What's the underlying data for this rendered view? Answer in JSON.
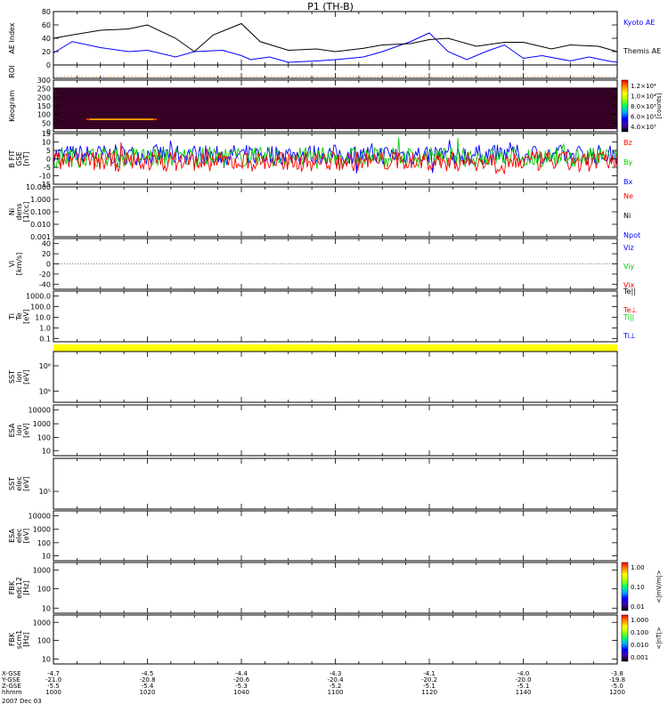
{
  "title": "P1 (TH-B)",
  "colors": {
    "black": "#000000",
    "red": "#ff0000",
    "green": "#00cc00",
    "blue": "#0000ff",
    "yellow": "#ffff00",
    "orange": "#ff9900",
    "kgram_bg": "#330022"
  },
  "x_axis": {
    "tick_values": [
      1000,
      1020,
      1040,
      1100,
      1120,
      1140,
      1200
    ],
    "row_labels": [
      "X-GSE",
      "Y-GSE",
      "Z-GSE",
      "hhmm",
      "2007 Dec 03"
    ],
    "rows": [
      [
        "-4.7",
        "-4.5",
        "-4.4",
        "-4.3",
        "-4.1",
        "-4.0",
        "-3.8"
      ],
      [
        "-21.0",
        "-20.8",
        "-20.6",
        "-20.4",
        "-20.2",
        "-20.0",
        "-19.8"
      ],
      [
        "-5.5",
        "-5.4",
        "-5.3",
        "-5.2",
        "-5.1",
        "-5.1",
        "-5.0"
      ],
      [
        "1000",
        "1020",
        "1040",
        "1100",
        "1120",
        "1140",
        "1200"
      ]
    ]
  },
  "chart_data": [
    {
      "type": "line",
      "ylabel": "AE Index",
      "ylim": [
        0,
        80
      ],
      "yticks": [
        "0",
        "20",
        "40",
        "60",
        "80"
      ],
      "series": [
        {
          "name": "Kyoto AE",
          "color": "#0000ff",
          "x": [
            1000,
            1004,
            1010,
            1016,
            1020,
            1026,
            1030,
            1036,
            1040,
            1042,
            1046,
            1050,
            1056,
            1100,
            1106,
            1110,
            1116,
            1120,
            1124,
            1128,
            1132,
            1136,
            1140,
            1144,
            1150,
            1154,
            1158,
            1200
          ],
          "y": [
            18,
            35,
            26,
            20,
            22,
            12,
            20,
            22,
            14,
            8,
            12,
            4,
            6,
            8,
            12,
            20,
            35,
            48,
            20,
            8,
            20,
            30,
            10,
            14,
            6,
            12,
            6,
            4
          ]
        },
        {
          "name": "Themis AE",
          "color": "#000000",
          "x": [
            1000,
            1004,
            1010,
            1016,
            1020,
            1026,
            1030,
            1034,
            1040,
            1044,
            1050,
            1056,
            1100,
            1106,
            1110,
            1116,
            1120,
            1124,
            1130,
            1136,
            1140,
            1146,
            1150,
            1156,
            1200
          ],
          "y": [
            40,
            45,
            52,
            54,
            60,
            40,
            20,
            45,
            62,
            35,
            22,
            24,
            20,
            25,
            30,
            32,
            38,
            40,
            28,
            34,
            34,
            24,
            30,
            28,
            20
          ]
        }
      ]
    },
    {
      "type": "line",
      "ylabel": "ROI",
      "series": [
        {
          "name": "",
          "color": "#ff9900",
          "x": [
            1000,
            1200
          ],
          "y": [
            0,
            0
          ]
        }
      ]
    },
    {
      "type": "heatmap",
      "ylabel": "Keogram",
      "ylim": [
        0,
        300
      ],
      "yticks": [
        "0",
        "50",
        "100",
        "150",
        "200",
        "250",
        "300"
      ],
      "colorbar": {
        "label": "[counts]",
        "ticks": [
          "1.2×10⁴",
          "1.0×10⁴",
          "8.0×10³",
          "6.0×10³",
          "4.0×10³"
        ],
        "tick_values": [
          12000,
          10000,
          8000,
          6000,
          4000
        ],
        "range": [
          3000,
          13000
        ]
      },
      "data_band": [
        15,
        255
      ],
      "feature": {
        "x_range": [
          1007,
          1022
        ],
        "y": 72
      }
    },
    {
      "type": "line",
      "ylabel": "B FIT\nGSE\n[nT]",
      "ylim": [
        -15,
        15
      ],
      "yticks": [
        "-15",
        "-10",
        "-5",
        "0",
        "5",
        "10",
        "15"
      ],
      "series": [
        {
          "name": "Bz",
          "color": "#ff0000",
          "mean": -1.5
        },
        {
          "name": "By",
          "color": "#00cc00",
          "mean": 1.0
        },
        {
          "name": "Bx",
          "color": "#0000ff",
          "mean": 2.5
        }
      ]
    },
    {
      "type": "line",
      "ylabel": "Ni\ndens\n[1/cc]",
      "ylim": [
        0.001,
        10
      ],
      "log": true,
      "yticks": [
        "0.001",
        "0.010",
        "0.100",
        "1.000",
        "10.000"
      ],
      "series": [
        {
          "name": "Ne",
          "color": "#ff0000"
        },
        {
          "name": "Ni",
          "color": "#000000"
        },
        {
          "name": "Npot",
          "color": "#0000ff"
        }
      ]
    },
    {
      "type": "line",
      "ylabel": "Vi\n[km/s]",
      "ylim": [
        -50,
        50
      ],
      "yticks": [
        "-40",
        "-20",
        "0",
        "20",
        "40"
      ],
      "series": [
        {
          "name": "Vix",
          "color": "#ff0000"
        },
        {
          "name": "Viy",
          "color": "#00cc00"
        },
        {
          "name": "Viz",
          "color": "#0000ff"
        }
      ]
    },
    {
      "type": "line",
      "ylabel": "Ti\nTe\n[eV]",
      "ylim": [
        0.05,
        3000
      ],
      "log": true,
      "yticks": [
        "0.1",
        "1.0",
        "10.0",
        "100.0",
        "1000.0"
      ],
      "series": [
        {
          "name": "Te||",
          "color": "#000000"
        },
        {
          "name": "Te⊥",
          "color": "#ff0000"
        },
        {
          "name": "Ti||",
          "color": "#00cc00"
        },
        {
          "name": "Ti⊥",
          "color": "#0000ff"
        }
      ]
    },
    {
      "type": "heatmap",
      "ylabel": "SST\nion\n[eV]",
      "yticks": [
        "10⁵",
        "10⁶"
      ]
    },
    {
      "type": "heatmap",
      "ylabel": "ESA\nion\n[eV]",
      "yticks": [
        "10",
        "100",
        "1000",
        "10000"
      ]
    },
    {
      "type": "heatmap",
      "ylabel": "SST\nelec\n[eV]",
      "yticks": [
        "10⁵"
      ]
    },
    {
      "type": "heatmap",
      "ylabel": "ESA\nelec\n[eV]",
      "yticks": [
        "10",
        "100",
        "1000",
        "10000"
      ]
    },
    {
      "type": "heatmap",
      "ylabel": "FBK\nedc12\n[Hz]",
      "yticks": [
        "10",
        "100",
        "1000"
      ],
      "colorbar": {
        "label": "<|mV/m|>",
        "ticks": [
          "1.00",
          "0.10",
          "0.01"
        ]
      }
    },
    {
      "type": "heatmap",
      "ylabel": "FBK\nscm1\n[Hz]",
      "yticks": [
        "10",
        "100",
        "1000"
      ],
      "colorbar": {
        "label": "<|nT|>",
        "ticks": [
          "1.000",
          "0.100",
          "0.010",
          "0.001"
        ]
      }
    }
  ]
}
